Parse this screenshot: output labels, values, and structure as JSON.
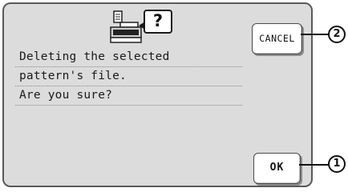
{
  "dialog": {
    "icon_glyph": "?",
    "message_lines": [
      "Deleting the selected",
      "pattern's file.",
      "Are you sure?"
    ]
  },
  "buttons": {
    "cancel_label": "CANCEL",
    "ok_label": "OK"
  },
  "callouts": {
    "cancel": "2",
    "ok": "1"
  },
  "icon": {
    "name": "embroidery-machine-icon"
  }
}
